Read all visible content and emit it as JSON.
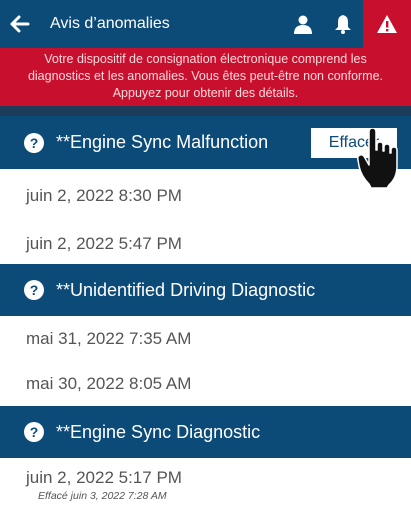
{
  "header": {
    "title": "Avis d’anomalies",
    "icons": [
      "back-arrow-icon",
      "user-icon",
      "bell-icon",
      "warning-icon"
    ]
  },
  "banner": {
    "lines": [
      "Votre dispositif de consignation électronique comprend les",
      "diagnostics et les anomalies. Vous êtes peut-être non conforme.",
      "Appuyez pour obtenir des détails."
    ]
  },
  "sections": [
    {
      "title": "**Engine Sync Malfunction",
      "button": "Effacer",
      "entries": [
        "juin 2, 2022 8:30 PM",
        "juin 2, 2022 5:47 PM"
      ]
    },
    {
      "title": "**Unidentified Driving Diagnostic",
      "entries": [
        "mai 31, 2022 7:35 AM",
        "mai 30, 2022 8:05 AM"
      ]
    },
    {
      "title": "**Engine Sync Diagnostic",
      "entries": [
        {
          "date": "juin 2, 2022 5:17 PM",
          "note": "Effacé juin 3, 2022 7:28 AM"
        }
      ]
    }
  ],
  "colors": {
    "header": "#0c4a78",
    "banner": "#c8102e",
    "divider": "#1d3c5a"
  }
}
